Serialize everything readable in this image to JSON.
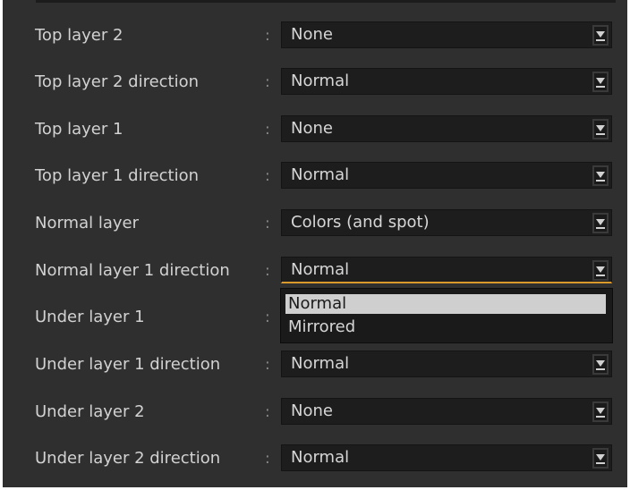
{
  "rows": [
    {
      "label": "Top layer 2",
      "value": "None"
    },
    {
      "label": "Top layer 2 direction",
      "value": "Normal"
    },
    {
      "label": "Top layer 1",
      "value": "None"
    },
    {
      "label": "Top layer 1 direction",
      "value": "Normal"
    },
    {
      "label": "Normal layer",
      "value": "Colors (and spot)"
    },
    {
      "label": "Normal layer 1 direction",
      "value": "Normal"
    },
    {
      "label": "Under layer 1",
      "value": ""
    },
    {
      "label": "Under layer 1 direction",
      "value": "Normal"
    },
    {
      "label": "Under layer 2",
      "value": "None"
    },
    {
      "label": "Under layer 2 direction",
      "value": "Normal"
    }
  ],
  "separator": ":",
  "open_dropdown": {
    "row_index": 5,
    "options": [
      "Normal",
      "Mirrored"
    ],
    "highlighted_index": 0
  },
  "colors": {
    "panel_background": "#2f2f2f",
    "select_background": "#1d1d1d",
    "focus_accent": "#d99a2b",
    "highlight": "#cfcfcf"
  },
  "icons": {
    "dropdown_arrow": "chevron-down-icon"
  }
}
